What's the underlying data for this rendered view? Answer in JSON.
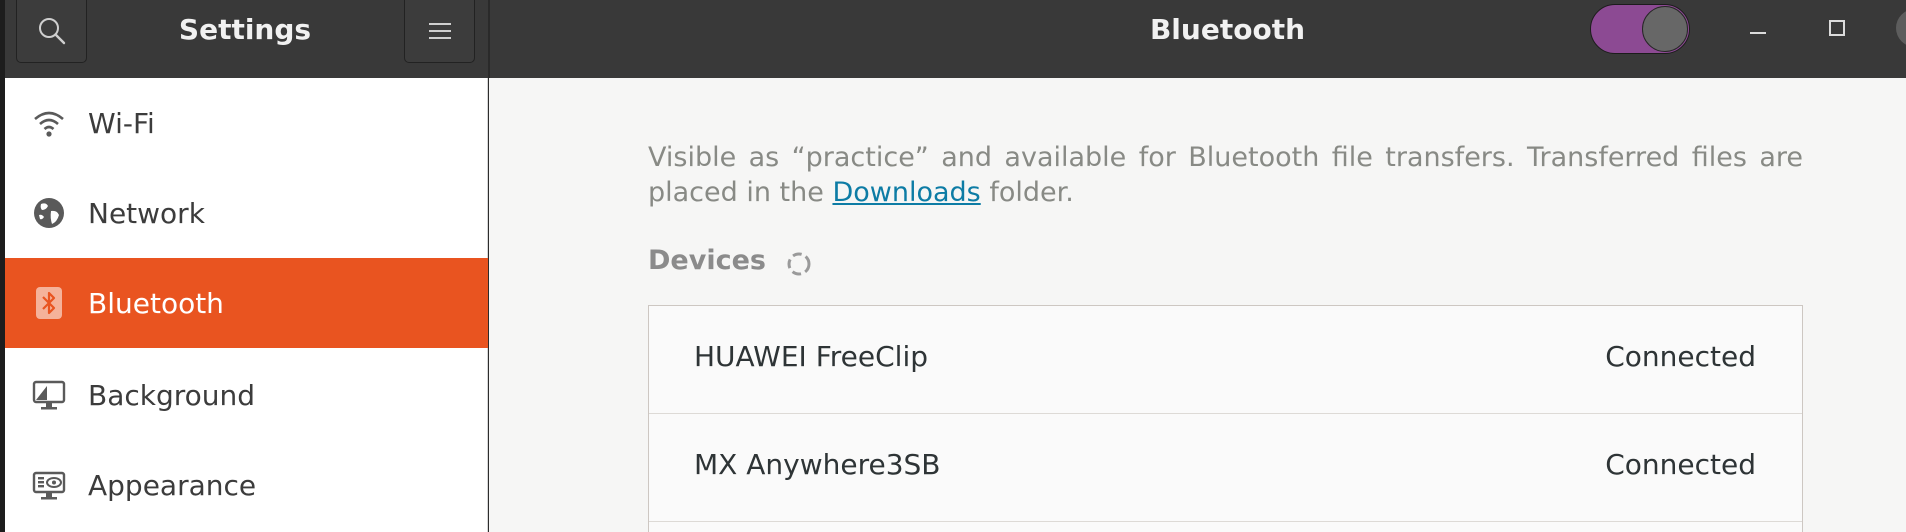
{
  "window": {
    "sidebar_title": "Settings",
    "page_title": "Bluetooth",
    "bluetooth_enabled": true,
    "accent_color": "#e95420",
    "toggle_color": "#8c4a93"
  },
  "sidebar": {
    "items": [
      {
        "label": "Wi-Fi",
        "icon": "wifi-icon"
      },
      {
        "label": "Network",
        "icon": "globe-icon"
      },
      {
        "label": "Bluetooth",
        "icon": "bluetooth-icon",
        "active": true
      },
      {
        "label": "Background",
        "icon": "monitor-icon"
      },
      {
        "label": "Appearance",
        "icon": "appearance-icon"
      }
    ]
  },
  "main": {
    "visibility_text_before": "Visible as “practice” and available for Bluetooth file transfers. Transferred files are placed in the ",
    "downloads_link": "Downloads",
    "visibility_text_after": " folder.",
    "devices_heading": "Devices",
    "devices": [
      {
        "name": "HUAWEI FreeClip",
        "status": "Connected"
      },
      {
        "name": "MX Anywhere3SB",
        "status": "Connected"
      }
    ]
  }
}
